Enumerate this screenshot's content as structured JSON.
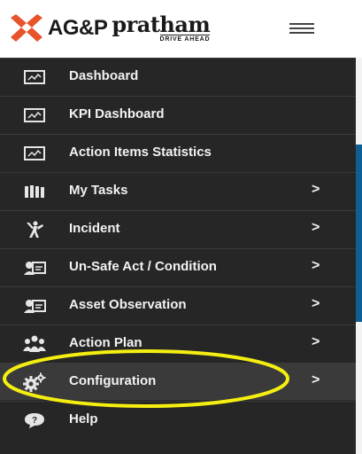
{
  "brand": {
    "name": "AG&P",
    "product": "pratham",
    "tagline": "DRIVE AHEAD",
    "accent_color": "#e8542a"
  },
  "header": {
    "menu_icon": "hamburger-icon"
  },
  "sidebar": {
    "items": [
      {
        "label": "Dashboard",
        "icon": "dashboard-icon",
        "has_submenu": false
      },
      {
        "label": "KPI Dashboard",
        "icon": "dashboard-icon",
        "has_submenu": false
      },
      {
        "label": "Action Items Statistics",
        "icon": "dashboard-icon",
        "has_submenu": false
      },
      {
        "label": "My Tasks",
        "icon": "tasks-icon",
        "has_submenu": true
      },
      {
        "label": "Incident",
        "icon": "incident-icon",
        "has_submenu": true
      },
      {
        "label": "Un-Safe Act / Condition",
        "icon": "id-card-icon",
        "has_submenu": true
      },
      {
        "label": "Asset Observation",
        "icon": "id-card-icon",
        "has_submenu": true
      },
      {
        "label": "Action Plan",
        "icon": "group-icon",
        "has_submenu": true
      },
      {
        "label": "Configuration",
        "icon": "gears-icon",
        "has_submenu": true,
        "active": true
      },
      {
        "label": "Help",
        "icon": "help-bubble-icon",
        "has_submenu": false
      }
    ],
    "chevron": ">"
  },
  "colors": {
    "sidebar_bg": "#262626",
    "active_bg": "#3a3a3a",
    "highlight_ring": "#f5ee11",
    "content_blue": "#0d5f94"
  }
}
